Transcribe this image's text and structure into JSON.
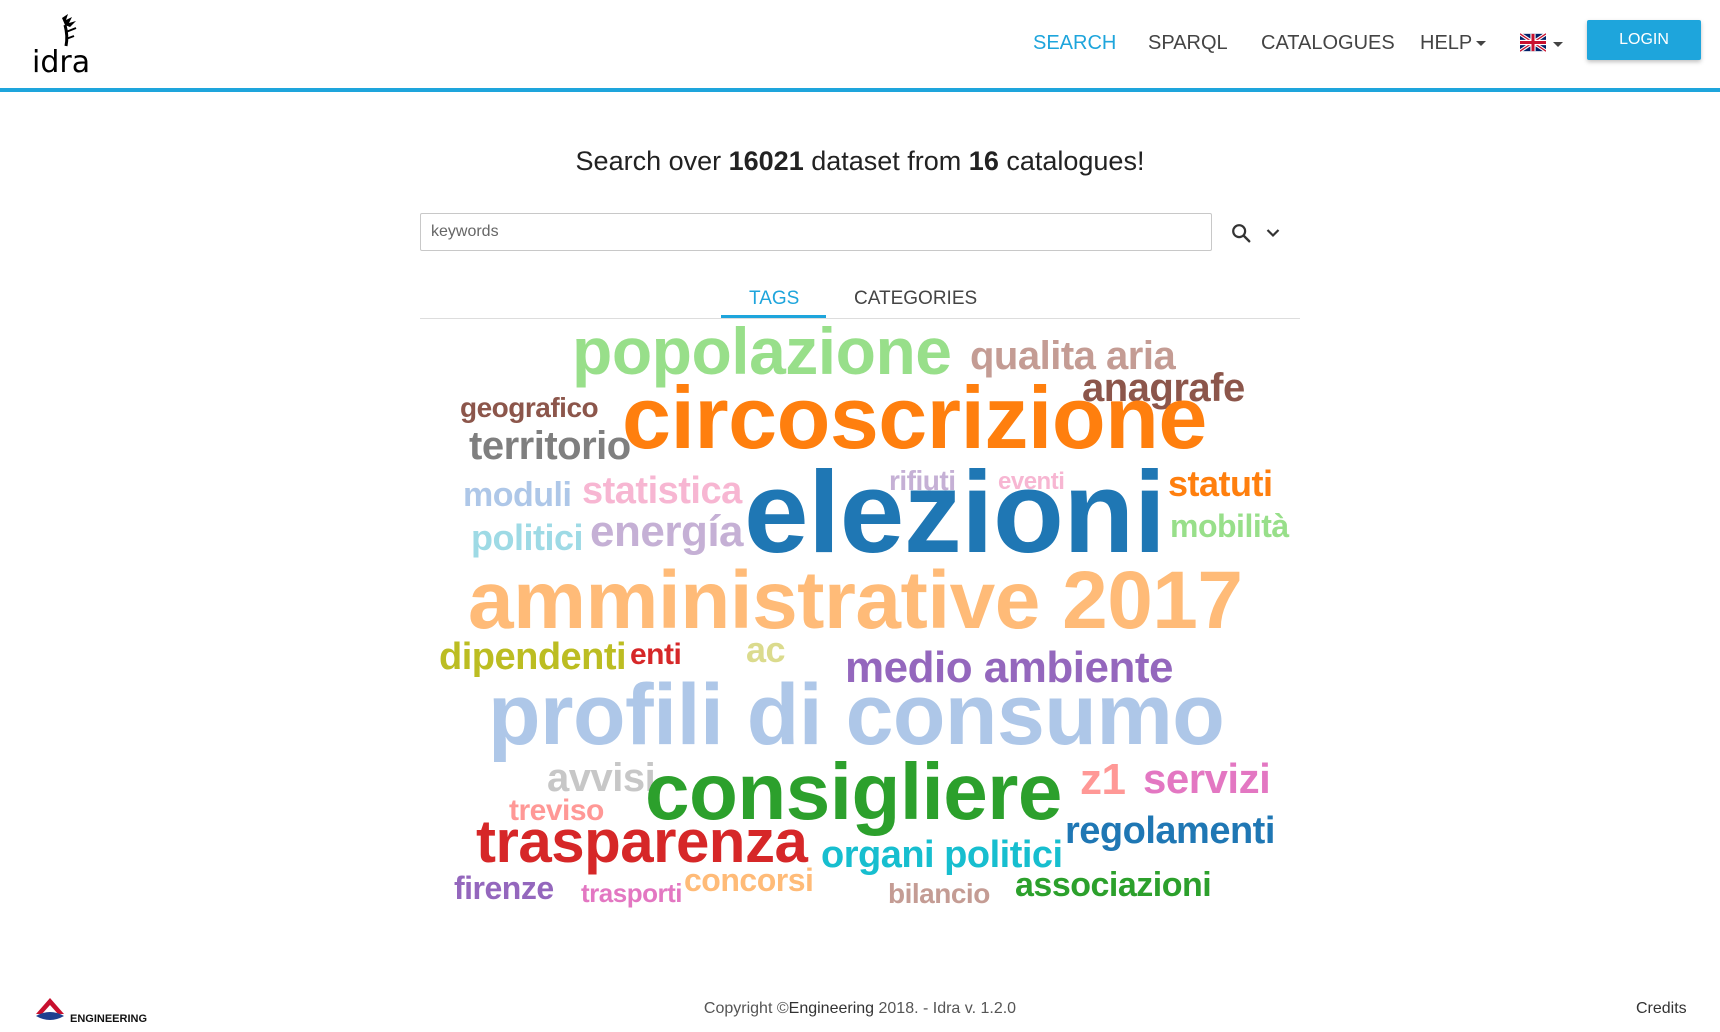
{
  "header": {
    "logo_text": "idra",
    "nav": {
      "search": "SEARCH",
      "sparql": "SPARQL",
      "catalogues": "CATALOGUES",
      "help": "HELP"
    },
    "language_flag": "uk-flag-icon",
    "login_label": "LOGIN"
  },
  "headline": {
    "prefix": "Search over ",
    "dataset_count": "16021",
    "middle": " dataset from ",
    "catalogue_count": "16",
    "suffix": " catalogues!"
  },
  "search": {
    "placeholder": "keywords",
    "value": ""
  },
  "tabs": {
    "tags": "TAGS",
    "categories": "CATEGORIES",
    "active": "TAGS"
  },
  "tag_cloud": [
    {
      "text": "popolazione",
      "color": "#98df8a"
    },
    {
      "text": "qualita aria",
      "color": "#c49c94"
    },
    {
      "text": "anagrafe",
      "color": "#8c564b"
    },
    {
      "text": "geografico",
      "color": "#8c564b"
    },
    {
      "text": "circoscrizione",
      "color": "#ff7f0e"
    },
    {
      "text": "territorio",
      "color": "#7f7f7f"
    },
    {
      "text": "moduli",
      "color": "#aec7e8"
    },
    {
      "text": "statistica",
      "color": "#f7b6d2"
    },
    {
      "text": "rifiuti",
      "color": "#c5b0d5"
    },
    {
      "text": "eventi",
      "color": "#f7b6d2"
    },
    {
      "text": "elezioni",
      "color": "#1f77b4"
    },
    {
      "text": "statuti",
      "color": "#ff7f0e"
    },
    {
      "text": "mobilità",
      "color": "#98df8a"
    },
    {
      "text": "politici",
      "color": "#9edae5"
    },
    {
      "text": "energía",
      "color": "#c5b0d5"
    },
    {
      "text": "amministrative 2017",
      "color": "#ffbb78"
    },
    {
      "text": "dipendenti",
      "color": "#bcbd22"
    },
    {
      "text": "enti",
      "color": "#d62728"
    },
    {
      "text": "ac",
      "color": "#dbdb8d"
    },
    {
      "text": "medio ambiente",
      "color": "#9467bd"
    },
    {
      "text": "profili di consumo",
      "color": "#aec7e8"
    },
    {
      "text": "avvisi",
      "color": "#c7c7c7"
    },
    {
      "text": "consigliere",
      "color": "#2ca02c"
    },
    {
      "text": "z1",
      "color": "#ff9896"
    },
    {
      "text": "servizi",
      "color": "#e377c2"
    },
    {
      "text": "treviso",
      "color": "#ff9896"
    },
    {
      "text": "trasparenza",
      "color": "#d62728"
    },
    {
      "text": "regolamenti",
      "color": "#1f77b4"
    },
    {
      "text": "organi politici",
      "color": "#17becf"
    },
    {
      "text": "firenze",
      "color": "#9467bd"
    },
    {
      "text": "trasporti",
      "color": "#e377c2"
    },
    {
      "text": "concorsi",
      "color": "#ffbb78"
    },
    {
      "text": "bilancio",
      "color": "#c49c94"
    },
    {
      "text": "associazioni",
      "color": "#2ca02c"
    }
  ],
  "footer": {
    "engineering_logo_text": "ENGINEERING",
    "copyright_prefix": "Copyright ©",
    "copyright_brand": "Engineering",
    "copyright_suffix": " 2018. - Idra v. 1.2.0",
    "credits": "Credits"
  },
  "colors": {
    "accent": "#1ea5dc"
  }
}
